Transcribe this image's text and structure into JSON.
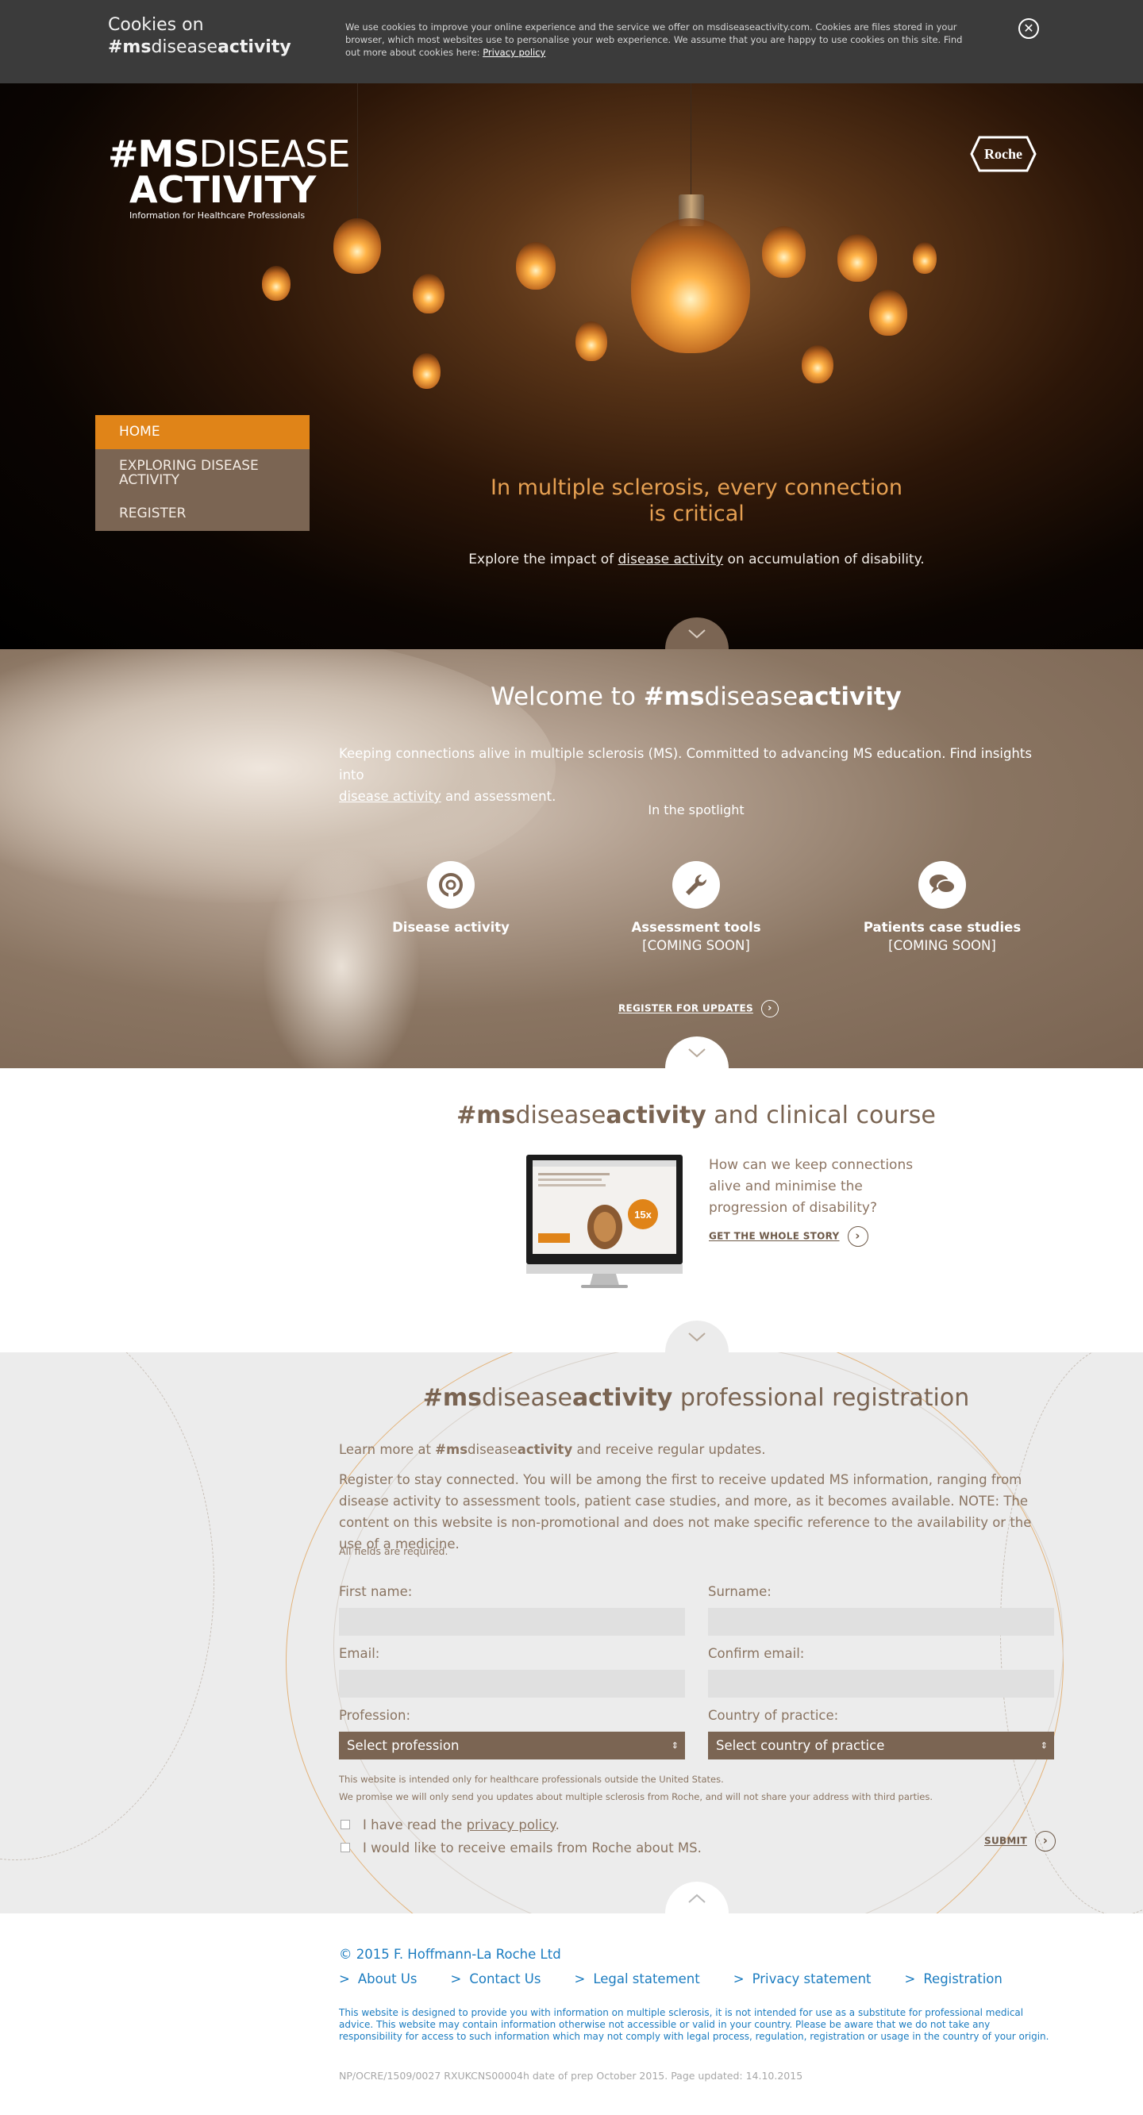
{
  "cookie": {
    "title_line1": "Cookies on",
    "title_brand_prefix": "#ms",
    "title_brand_mid": "disease",
    "title_brand_bold": "activity",
    "text": "We use cookies to improve your online experience and the service we offer on msdiseaseactivity.com. Cookies are files stored in your browser, which most websites use to personalise your web experience. We assume that you are happy to use cookies on this site. Find out more about cookies here: ",
    "link": "Privacy policy",
    "close_icon": "close-icon"
  },
  "header": {
    "logo_hash": "#",
    "logo_ms": "MS",
    "logo_disease": "DISEASE",
    "logo_activity": "ACTIVITY",
    "logo_tagline": "Information for Healthcare Professionals",
    "roche_logo": "Roche"
  },
  "nav": {
    "items": [
      {
        "label": "HOME"
      },
      {
        "label": "EXPLORING DISEASE ACTIVITY"
      },
      {
        "label": "REGISTER"
      }
    ]
  },
  "hero": {
    "headline_line1": "In multiple sclerosis, every connection",
    "headline_line2": "is critical",
    "sub_prefix": "Explore the impact of ",
    "sub_link": "disease activity",
    "sub_suffix": " on accumulation of disability."
  },
  "welcome": {
    "title_prefix": "Welcome to ",
    "title_ms": "#ms",
    "title_disease": "disease",
    "title_activity": "activity",
    "text_line1": "Keeping connections alive in multiple sclerosis (MS). Committed to advancing MS education. Find insights into",
    "text_link": "disease activity",
    "text_suffix": " and assessment.",
    "spotlight": "In the spotlight",
    "items": [
      {
        "label": "Disease activity",
        "sub": "",
        "icon": "target-icon"
      },
      {
        "label": "Assessment tools",
        "sub": "[COMING SOON]",
        "icon": "wrench-icon"
      },
      {
        "label": "Patients case studies",
        "sub": "[COMING SOON]",
        "icon": "chat-bubbles-icon"
      }
    ],
    "register_link": "REGISTER FOR UPDATES"
  },
  "clinical": {
    "title_ms": "#ms",
    "title_disease": "disease",
    "title_activity": "activity",
    "title_suffix": " and clinical course",
    "text": "How can we keep connections alive and minimise the progression of disability?",
    "link": "GET THE WHOLE STORY",
    "monitor_badge": "15x"
  },
  "registration": {
    "title_ms": "#ms",
    "title_disease": "disease",
    "title_activity": "activity",
    "title_suffix": " professional registration",
    "p1_prefix": "Learn more at ",
    "p1_ms": "#ms",
    "p1_disease": "disease",
    "p1_activity": "activity",
    "p1_suffix": " and receive regular updates.",
    "p2": "Register to stay connected. You will be among the first to receive updated MS information, ranging from disease activity to assessment tools, patient case studies, and more, as it becomes available. NOTE: The content on this website is non-promotional and does not make specific reference to the availability or the use of a medicine.",
    "required": "All fields are required.",
    "first_name_label": "First name:",
    "surname_label": "Surname:",
    "email_label": "Email:",
    "confirm_email_label": "Confirm email:",
    "profession_label": "Profession:",
    "country_label": "Country of practice:",
    "profession_select": "Select profession",
    "country_select": "Select country of practice",
    "note1": "This website is intended only for healthcare professionals outside the United States.",
    "note2": "We promise we will only send you updates about multiple sclerosis from Roche, and will not share your address with third parties.",
    "check1_prefix": "I have read the ",
    "check1_link": "privacy policy",
    "check1_suffix": ".",
    "check2": "I would like to receive emails from Roche about MS.",
    "submit": "SUBMIT"
  },
  "footer": {
    "copyright": "© 2015 F. Hoffmann-La Roche Ltd",
    "links": [
      "About Us",
      "Contact Us",
      "Legal statement",
      "Privacy statement",
      "Registration"
    ],
    "link_marker": ">",
    "disclaimer": "This website is designed to provide you with information on multiple sclerosis, it is not intended for use as a substitute for professional medical advice. This website may contain information otherwise not accessible or valid in your country. Please be aware that we do not take any responsibility for access to such information which may not comply with legal process, regulation, registration or usage in the country of your origin.",
    "np_code": "NP/OCRE/1509/0027 RXUKCNS00004h date of prep October 2015. Page updated: 14.10.2015"
  },
  "colors": {
    "accent_orange": "#e08418",
    "brand_brown": "#7b6553",
    "footer_blue": "#1b7cc0"
  }
}
